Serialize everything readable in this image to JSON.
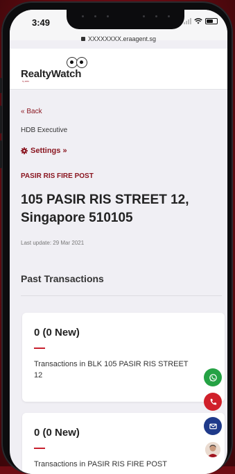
{
  "status_bar": {
    "time": "3:49"
  },
  "browser": {
    "url": "XXXXXXXX.eraagent.sg"
  },
  "site": {
    "logo_text": "RealtyWatch",
    "logo_subtext": "by ERA"
  },
  "page": {
    "back_link": "« Back",
    "property_type": "HDB Executive",
    "settings_label": "Settings »",
    "category": "PASIR RIS FIRE POST",
    "address": "105 PASIR RIS STREET 12, Singapore 510105",
    "last_update": "Last update: 29 Mar 2021",
    "section_title": "Past Transactions"
  },
  "cards": [
    {
      "count": "0 (0 New)",
      "description": "Transactions in BLK 105 PASIR RIS STREET 12"
    },
    {
      "count": "0 (0 New)",
      "description": "Transactions in PASIR RIS FIRE POST"
    }
  ],
  "floating_buttons": [
    {
      "icon": "whatsapp-icon",
      "color": "#25a244"
    },
    {
      "icon": "phone-icon",
      "color": "#d0202a"
    },
    {
      "icon": "email-icon",
      "color": "#1f3a8a"
    },
    {
      "icon": "agent-avatar"
    }
  ],
  "colors": {
    "accent": "#8a1620",
    "background": "#f0eff4"
  }
}
